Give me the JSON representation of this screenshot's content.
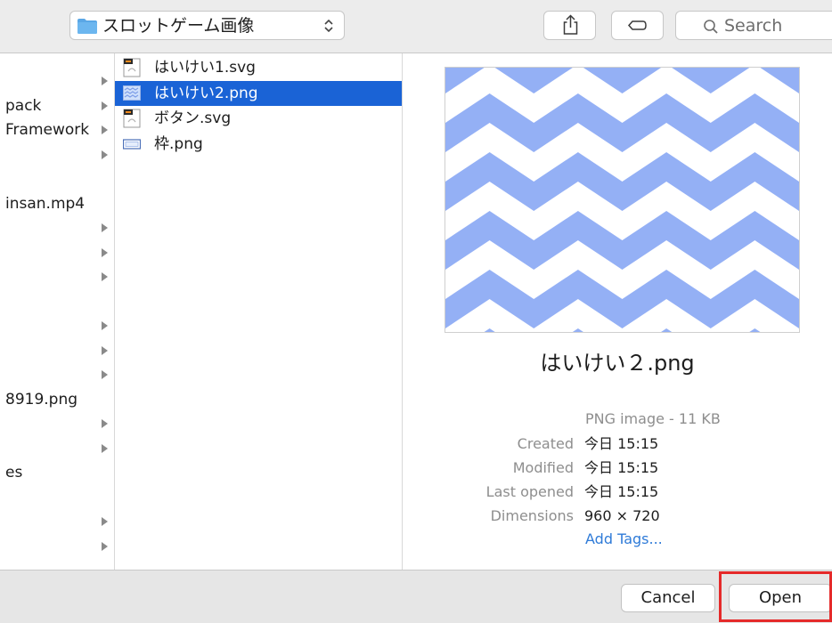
{
  "toolbar": {
    "path_label": "スロットゲーム画像",
    "search_placeholder": "Search",
    "folder_color": "#5aa7e6"
  },
  "sidebar_column": {
    "items": [
      {
        "label": "",
        "has_arrow": true
      },
      {
        "label": "pack",
        "has_arrow": true
      },
      {
        "label": "Framework",
        "has_arrow": true
      },
      {
        "label": "",
        "has_arrow": true
      },
      {
        "label": "",
        "has_arrow": false
      },
      {
        "label": "insan.mp4",
        "has_arrow": false
      },
      {
        "label": "",
        "has_arrow": true
      },
      {
        "label": "",
        "has_arrow": true
      },
      {
        "label": "",
        "has_arrow": true
      },
      {
        "label": "",
        "has_arrow": false
      },
      {
        "label": "",
        "has_arrow": true
      },
      {
        "label": "",
        "has_arrow": true
      },
      {
        "label": "",
        "has_arrow": true
      },
      {
        "label": "8919.png",
        "has_arrow": false
      },
      {
        "label": "",
        "has_arrow": true
      },
      {
        "label": "",
        "has_arrow": true
      },
      {
        "label": "es",
        "has_arrow": false
      },
      {
        "label": "",
        "has_arrow": false
      },
      {
        "label": "",
        "has_arrow": true
      },
      {
        "label": "",
        "has_arrow": true
      }
    ]
  },
  "files": [
    {
      "name": "はいけい1.svg",
      "icon": "svg-file-icon",
      "selected": false
    },
    {
      "name": "はいけい2.png",
      "icon": "png-image-icon",
      "selected": true
    },
    {
      "name": "ボタン.svg",
      "icon": "svg-file-icon",
      "selected": false
    },
    {
      "name": "枠.png",
      "icon": "png-frame-icon",
      "selected": false
    }
  ],
  "preview": {
    "file_name": "はいけい２.png",
    "kind": "PNG image - 11 KB",
    "pattern_color": "#94b0f5",
    "meta": [
      {
        "key": "Created",
        "value": "今日 15:15"
      },
      {
        "key": "Modified",
        "value": "今日 15:15"
      },
      {
        "key": "Last opened",
        "value": "今日 15:15"
      },
      {
        "key": "Dimensions",
        "value": "960 × 720"
      }
    ],
    "add_tags": "Add Tags..."
  },
  "buttons": {
    "cancel": "Cancel",
    "open": "Open",
    "highlight_color": "#e52a2a"
  }
}
